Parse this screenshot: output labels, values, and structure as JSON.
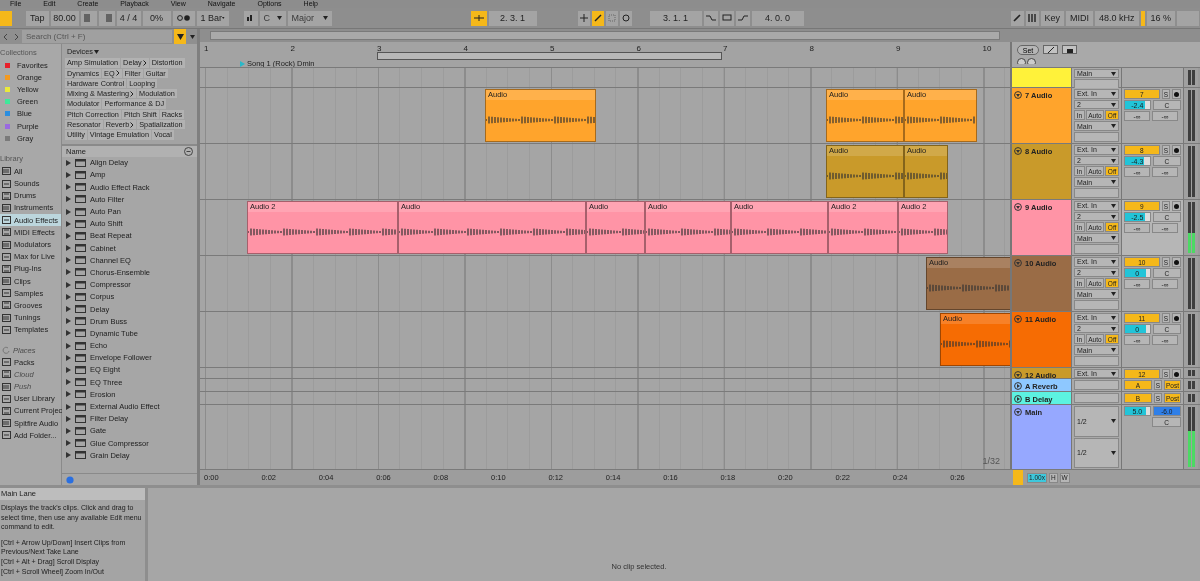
{
  "menu": [
    {
      "label": "File"
    },
    {
      "label": "Edit"
    },
    {
      "label": "Create"
    },
    {
      "label": "Playback"
    },
    {
      "label": "View"
    },
    {
      "label": "Navigate"
    },
    {
      "label": "Options"
    },
    {
      "label": "Help"
    }
  ],
  "control_bar": {
    "tap": "Tap",
    "tempo": "80.00",
    "signature": "4 / 4",
    "groove": "0%",
    "quantize": "1 Bar",
    "key": "C",
    "scale": "Major",
    "position": "2.   3.   1",
    "loop_start": "3.   1.   1",
    "loop_length": "4.   0.   0",
    "key_map": "Key",
    "midi_map": "MIDI",
    "sample_rate": "48.0 kHz",
    "cpu": "16 %"
  },
  "browser": {
    "search": {
      "placeholder": "Search (Ctrl + F)"
    },
    "collections_title": "Collections",
    "collections": [
      {
        "label": "Favorites",
        "color": "#e8202a"
      },
      {
        "label": "Orange",
        "color": "#f39a1f"
      },
      {
        "label": "Yellow",
        "color": "#eaea3a"
      },
      {
        "label": "Green",
        "color": "#3ee89a"
      },
      {
        "label": "Blue",
        "color": "#2a8ee0"
      },
      {
        "label": "Purple",
        "color": "#9a6ae0"
      },
      {
        "label": "Gray",
        "color": "#7a7a7a"
      }
    ],
    "library_title": "Library",
    "library": [
      {
        "label": "All",
        "selected": false
      },
      {
        "label": "Sounds",
        "selected": false
      },
      {
        "label": "Drums",
        "selected": false
      },
      {
        "label": "Instruments",
        "selected": false
      },
      {
        "label": "Audio Effects",
        "selected": true
      },
      {
        "label": "MIDI Effects",
        "selected": false
      },
      {
        "label": "Modulators",
        "selected": false
      },
      {
        "label": "Max for Live",
        "selected": false
      },
      {
        "label": "Plug-Ins",
        "selected": false
      },
      {
        "label": "Clips",
        "selected": false
      },
      {
        "label": "Samples",
        "selected": false
      },
      {
        "label": "Grooves",
        "selected": false
      },
      {
        "label": "Tunings",
        "selected": false
      },
      {
        "label": "Templates",
        "selected": false
      }
    ],
    "places_title": "Places",
    "places": [
      {
        "label": "Packs",
        "disabled": false
      },
      {
        "label": "Cloud",
        "disabled": true
      },
      {
        "label": "Push",
        "disabled": true
      },
      {
        "label": "User Library",
        "disabled": false
      },
      {
        "label": "Current Projec",
        "disabled": false
      },
      {
        "label": "Spitfire Audio",
        "disabled": false
      },
      {
        "label": "Add Folder...",
        "disabled": false
      }
    ],
    "devices_title": "Devices",
    "tags": [
      {
        "label": "Amp Simulation",
        "submenu": false
      },
      {
        "label": "Delay",
        "submenu": true
      },
      {
        "label": "Distortion",
        "submenu": false
      },
      {
        "label": "Dynamics",
        "submenu": false
      },
      {
        "label": "EQ",
        "submenu": true
      },
      {
        "label": "Filter",
        "submenu": false
      },
      {
        "label": "Guitar",
        "submenu": false
      },
      {
        "label": "Hardware Control",
        "submenu": false
      },
      {
        "label": "Looping",
        "submenu": false
      },
      {
        "label": "Mixing & Mastering",
        "submenu": true
      },
      {
        "label": "Modulation",
        "submenu": false
      },
      {
        "label": "Modulator",
        "submenu": false
      },
      {
        "label": "Performance & DJ",
        "submenu": false
      },
      {
        "label": "Pitch Correction",
        "submenu": false
      },
      {
        "label": "Pitch Shift",
        "submenu": false
      },
      {
        "label": "Racks",
        "submenu": false
      },
      {
        "label": "Resonator",
        "submenu": false
      },
      {
        "label": "Reverb",
        "submenu": true
      },
      {
        "label": "Spatialization",
        "submenu": false
      },
      {
        "label": "Utility",
        "submenu": false
      },
      {
        "label": "Vintage Emulation",
        "submenu": false
      },
      {
        "label": "Vocal",
        "submenu": false
      }
    ],
    "list_header": "Name",
    "items": [
      {
        "label": "Align Delay"
      },
      {
        "label": "Amp"
      },
      {
        "label": "Audio Effect Rack"
      },
      {
        "label": "Auto Filter"
      },
      {
        "label": "Auto Pan"
      },
      {
        "label": "Auto Shift"
      },
      {
        "label": "Beat Repeat"
      },
      {
        "label": "Cabinet"
      },
      {
        "label": "Channel EQ"
      },
      {
        "label": "Chorus-Ensemble"
      },
      {
        "label": "Compressor"
      },
      {
        "label": "Corpus"
      },
      {
        "label": "Delay"
      },
      {
        "label": "Drum Buss"
      },
      {
        "label": "Dynamic Tube"
      },
      {
        "label": "Echo"
      },
      {
        "label": "Envelope Follower"
      },
      {
        "label": "EQ Eight"
      },
      {
        "label": "EQ Three"
      },
      {
        "label": "Erosion"
      },
      {
        "label": "External Audio Effect"
      },
      {
        "label": "Filter Delay"
      },
      {
        "label": "Gate"
      },
      {
        "label": "Glue Compressor"
      },
      {
        "label": "Grain Delay"
      }
    ]
  },
  "arrangement": {
    "bars": [
      "1",
      "2",
      "3",
      "4",
      "5",
      "6",
      "7",
      "8",
      "9",
      "10"
    ],
    "locator": "Song 1 (Rock) Dmin",
    "set": "Set",
    "tracks": [
      {
        "kind": "clipped",
        "color": "#fff23a",
        "output": "Main"
      },
      {
        "kind": "audio",
        "name": "7 Audio",
        "color": "#ffa42c",
        "input": "Ext. In",
        "channel": "2",
        "monitor": [
          {
            "label": "In",
            "selected": false
          },
          {
            "label": "Auto",
            "selected": false
          },
          {
            "label": "Off",
            "selected": true
          }
        ],
        "output": "Main",
        "number": "7",
        "volume": "-2.4",
        "level": 0.8,
        "pan": "C",
        "sends": [
          "-∞",
          "-∞"
        ],
        "solo": "S",
        "clips": [
          {
            "name": "Audio"
          },
          {
            "name": "Audio"
          },
          {
            "name": "Audio"
          }
        ]
      },
      {
        "kind": "audio",
        "name": "8 Audio",
        "color": "#c99a2a",
        "input": "Ext. In",
        "channel": "2",
        "monitor": [
          {
            "label": "In",
            "selected": false
          },
          {
            "label": "Auto",
            "selected": false
          },
          {
            "label": "Off",
            "selected": true
          }
        ],
        "output": "Main",
        "number": "8",
        "volume": "-4.3",
        "level": 0.78,
        "pan": "C",
        "sends": [
          "-∞",
          "-∞"
        ],
        "solo": "S",
        "clips": [
          {
            "name": "Audio"
          },
          {
            "name": "Audio"
          }
        ]
      },
      {
        "kind": "audio",
        "name": "9 Audio",
        "color": "#ff94a6",
        "input": "Ext. In",
        "channel": "2",
        "monitor": [
          {
            "label": "In",
            "selected": false
          },
          {
            "label": "Auto",
            "selected": false
          },
          {
            "label": "Off",
            "selected": true
          }
        ],
        "output": "Main",
        "number": "9",
        "volume": "-2.5",
        "level": 0.8,
        "pan": "C",
        "sends": [
          "-∞",
          "-∞"
        ],
        "solo": "S",
        "clips": [
          {
            "name": "Audio 2"
          },
          {
            "name": "Audio"
          },
          {
            "name": "Audio"
          },
          {
            "name": "Audio"
          },
          {
            "name": "Audio"
          },
          {
            "name": "Audio 2"
          },
          {
            "name": "Audio 2"
          }
        ]
      },
      {
        "kind": "audio",
        "name": "10 Audio",
        "color": "#9a6c46",
        "input": "Ext. In",
        "channel": "2",
        "monitor": [
          {
            "label": "In",
            "selected": false
          },
          {
            "label": "Auto",
            "selected": false
          },
          {
            "label": "Off",
            "selected": true
          }
        ],
        "output": "Main",
        "number": "10",
        "volume": "0",
        "level": 0.85,
        "pan": "C",
        "sends": [
          "-∞",
          "-∞"
        ],
        "solo": "S",
        "clips": [
          {
            "name": "Audio"
          }
        ]
      },
      {
        "kind": "audio",
        "name": "11 Audio",
        "color": "#f66c03",
        "input": "Ext. In",
        "channel": "2",
        "monitor": [
          {
            "label": "In",
            "selected": false
          },
          {
            "label": "Auto",
            "selected": false
          },
          {
            "label": "Off",
            "selected": true
          }
        ],
        "output": "Main",
        "number": "11",
        "volume": "0",
        "level": 0.85,
        "pan": "C",
        "sends": [
          "-∞",
          "-∞"
        ],
        "solo": "S",
        "clips": [
          {
            "name": "Audio"
          }
        ]
      },
      {
        "kind": "folded",
        "name": "12 Audio",
        "color": "#c99a2a",
        "input": "Ext. In",
        "number": "12",
        "solo": "S"
      },
      {
        "kind": "return",
        "name": "A Reverb",
        "color": "#8ec8ff",
        "number": "A",
        "solo": "S",
        "post": "Post"
      },
      {
        "kind": "return",
        "name": "B Delay",
        "color": "#5cf2e0",
        "number": "B",
        "solo": "S",
        "post": "Post"
      },
      {
        "kind": "main",
        "name": "Main",
        "color": "#96a8ff",
        "inputs": [
          "1/2",
          "1/2"
        ],
        "number": "5.0",
        "volume": "-6.0",
        "level": 0.85,
        "pan": "C"
      }
    ],
    "times": [
      "0:00",
      "0:02",
      "0:04",
      "0:06",
      "0:08",
      "0:10",
      "0:12",
      "0:14",
      "0:16",
      "0:18",
      "0:20",
      "0:22",
      "0:24",
      "0:26"
    ],
    "grid": "1/32",
    "zoom": "1.00x",
    "h": "H",
    "w": "W"
  },
  "info": {
    "title": "Main Lane",
    "body": "Displays the track's clips. Click and drag to select time, then use any available Edit menu command to edit.",
    "shortcuts": [
      "[Ctrl + Arrow Up/Down] Insert Clips from Previous/Next Take Lane",
      "[Ctrl + Alt + Drag] Scroll Display",
      "[Ctrl + Scroll Wheel] Zoom In/Out"
    ]
  },
  "detail": {
    "message": "No clip selected."
  }
}
